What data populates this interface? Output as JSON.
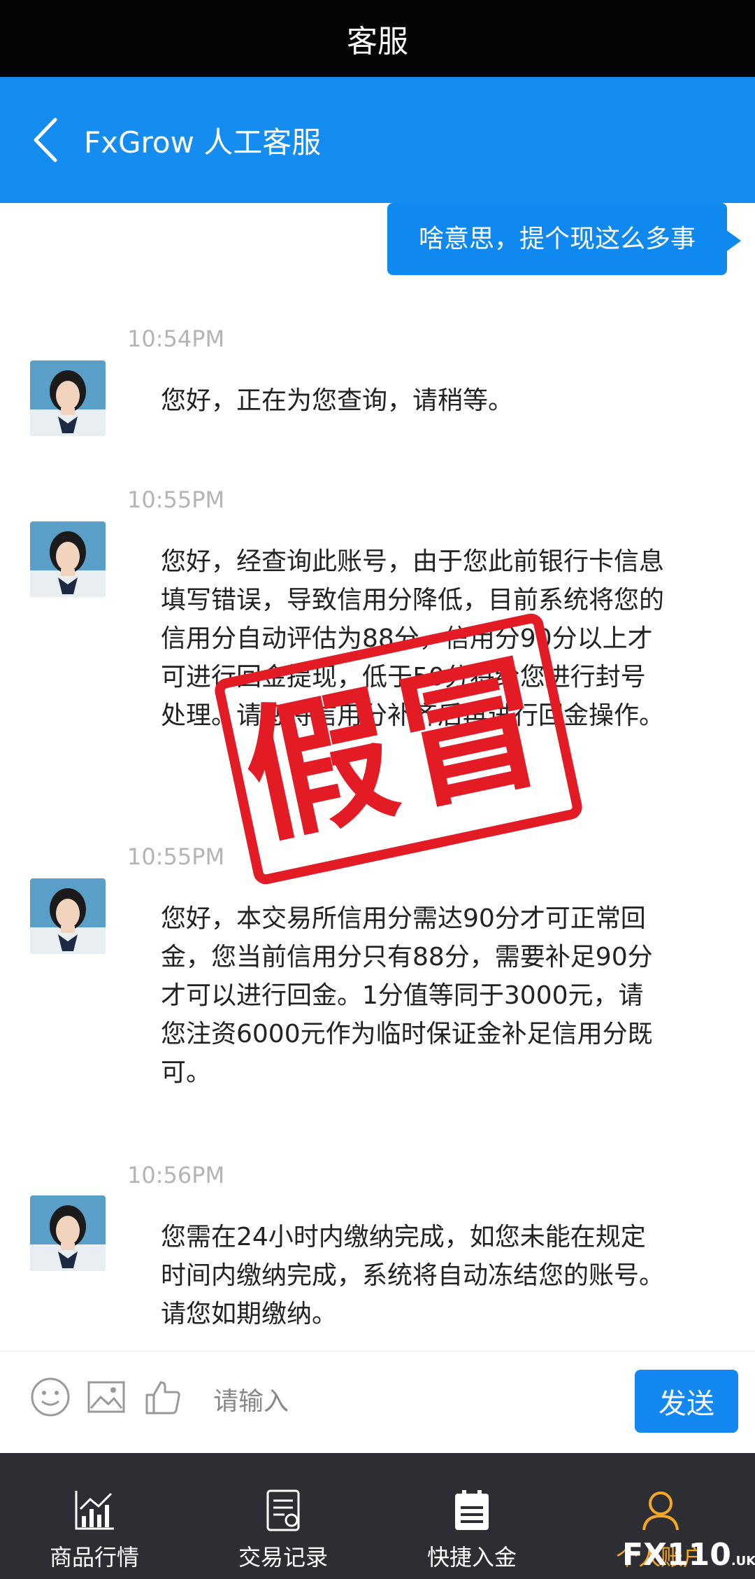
{
  "status_bar": {
    "title": "客服"
  },
  "header": {
    "title": "FxGrow 人工客服"
  },
  "outgoing": {
    "text": "啥意思，提个现这么多事"
  },
  "messages": [
    {
      "time": "10:54PM",
      "text": "您好，正在为您查询，请稍等。"
    },
    {
      "time": "10:55PM",
      "text": "您好，经查询此账号，由于您此前银行卡信息填写错误，导致信用分降低，目前系统将您的信用分自动评估为88分，信用分90分以上才可进行回金提现，低于50分将给您进行封号处理。请您将信用分补齐后再进行回金操作。"
    },
    {
      "time": "10:55PM",
      "text": "您好，本交易所信用分需达90分才可正常回金，您当前信用分只有88分，需要补足90分才可以进行回金。1分值等同于3000元，请您注资6000元作为临时保证金补足信用分既可。"
    },
    {
      "time": "10:56PM",
      "text": "您需在24小时内缴纳完成，如您未能在规定时间内缴纳完成，系统将自动冻结您的账号。请您如期缴纳。"
    }
  ],
  "input": {
    "placeholder": "请输入",
    "send_label": "发送"
  },
  "stamp": {
    "text": "假冒"
  },
  "tabs": [
    {
      "label": "商品行情",
      "icon": "chart-icon"
    },
    {
      "label": "交易记录",
      "icon": "record-icon"
    },
    {
      "label": "快捷入金",
      "icon": "deposit-icon"
    },
    {
      "label": "个人账户",
      "icon": "user-icon"
    }
  ],
  "brand": {
    "text": "FX110",
    "suffix": ".UK"
  },
  "colors": {
    "accent": "#148cf0",
    "stamp": "#e21b24",
    "tab_active": "#f6a623",
    "tabbar": "#2d2e34"
  }
}
